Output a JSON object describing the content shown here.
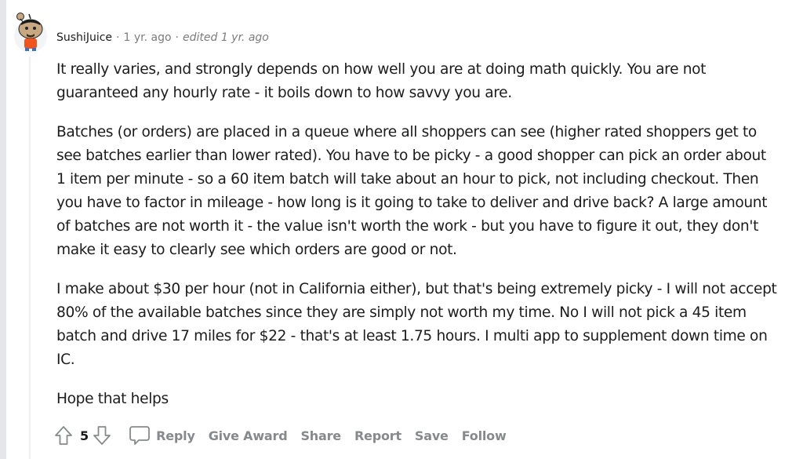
{
  "comment": {
    "author": "SushiJuice",
    "separator": "·",
    "time": "1 yr. ago",
    "edited": "edited 1 yr. ago",
    "paragraphs": [
      "It really varies, and strongly depends on how well you are at doing math quickly. You are not guaranteed any hourly rate - it boils down to how savvy you are.",
      "Batches (or orders) are placed in a queue where all shoppers can see (higher rated shoppers get to see batches earlier than lower rated). You have to be picky - a good shopper can pick an order about 1 item per minute - so a 60 item batch will take about an hour to pick, not including checkout. Then you have to factor in mileage - how long is it going to take to deliver and drive back? A large amount of batches are not worth it - the value isn't worth the work - but you have to figure it out, they don't make it easy to clearly see which orders are good or not.",
      "I make about $30 per hour (not in California either), but that's being extremely picky - I will not accept 80% of the available batches since they are simply not worth my time. No I will not pick a 45 item batch and drive 17 miles for $22 - that's at least 1.75 hours. I multi app to supplement down time on IC.",
      "Hope that helps"
    ],
    "score": "5",
    "icons": {
      "avatar": "snoo-avatar",
      "upvote": "upvote-arrow-icon",
      "downvote": "downvote-arrow-icon",
      "reply": "speech-bubble-icon"
    },
    "actions": [
      "Reply",
      "Give Award",
      "Share",
      "Report",
      "Save",
      "Follow"
    ]
  }
}
